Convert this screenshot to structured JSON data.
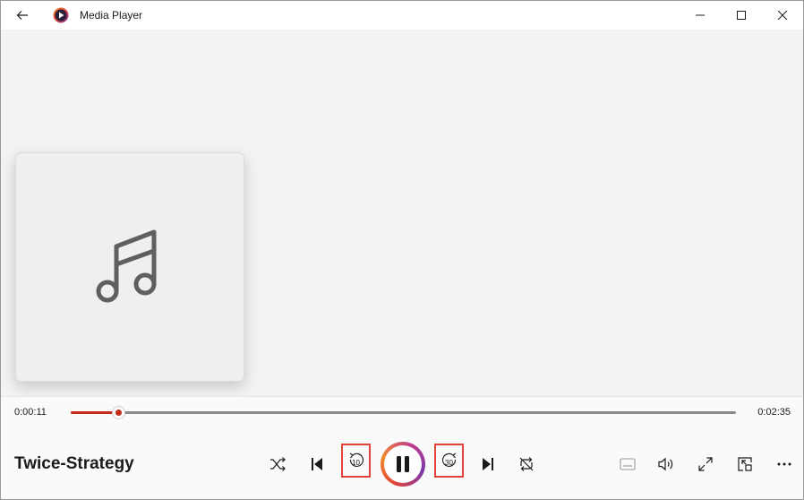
{
  "window": {
    "title": "Media Player",
    "accent_color": "#c42b1c"
  },
  "titlebar": {
    "back_icon": "arrow-left-icon",
    "app_icon": "media-player-logo-icon",
    "minimize_icon": "minimize-icon",
    "maximize_icon": "maximize-icon",
    "close_icon": "close-icon"
  },
  "album_art": {
    "icon": "music-note-icon"
  },
  "playback": {
    "current_time": "0:00:11",
    "total_time": "0:02:35",
    "progress": 0.071,
    "track_title": "Twice-Strategy"
  },
  "controls": {
    "shuffle_icon": "shuffle-icon",
    "previous_icon": "previous-track-icon",
    "skip_back_label": "10",
    "pause_icon": "pause-icon",
    "skip_forward_label": "30",
    "next_icon": "next-track-icon",
    "repeat_icon": "repeat-icon",
    "captions_icon": "captions-icon",
    "volume_icon": "volume-icon",
    "fullscreen_icon": "fullscreen-icon",
    "miniplayer_icon": "mini-player-icon",
    "more_icon": "more-options-icon"
  }
}
